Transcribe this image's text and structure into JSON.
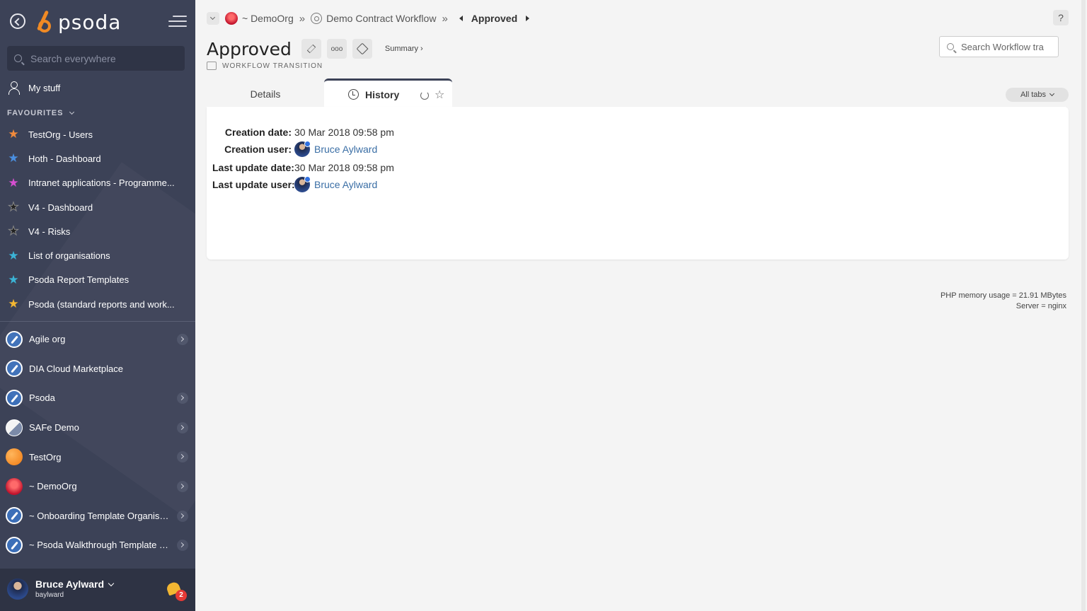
{
  "sidebar": {
    "logo_text": "psoda",
    "search_placeholder": "Search everywhere",
    "my_stuff": "My stuff",
    "favourites_header": "FAVOURITES",
    "favourites": [
      {
        "label": "TestOrg - Users",
        "color": "#f08a3c"
      },
      {
        "label": "Hoth - Dashboard",
        "color": "#4a8fe0"
      },
      {
        "label": "Intranet applications - Programme...",
        "color": "#d64fd0"
      },
      {
        "label": "V4 - Dashboard",
        "color": "#222222"
      },
      {
        "label": "V4 - Risks",
        "color": "#222222"
      },
      {
        "label": "List of organisations",
        "color": "#3bb4d6"
      },
      {
        "label": "Psoda Report Templates",
        "color": "#3bb4d6"
      },
      {
        "label": "Psoda (standard reports and work...",
        "color": "#f2b632"
      }
    ],
    "orgs": [
      {
        "label": "Agile org",
        "icon": "rocket"
      },
      {
        "label": "DIA Cloud Marketplace",
        "icon": "rocket"
      },
      {
        "label": "Psoda",
        "icon": "rocket"
      },
      {
        "label": "SAFe Demo",
        "icon": "safe"
      },
      {
        "label": "TestOrg",
        "icon": "testorg"
      },
      {
        "label": "~ DemoOrg",
        "icon": "demoorg"
      },
      {
        "label": "~ Onboarding Template Organisa...",
        "icon": "rocket"
      },
      {
        "label": "~ Psoda Walkthrough Template P...",
        "icon": "rocket"
      }
    ],
    "user": {
      "name": "Bruce Aylward",
      "login": "baylward",
      "notifications": "2"
    }
  },
  "breadcrumb": {
    "org": "~ DemoOrg",
    "workflow": "Demo Contract Workflow",
    "current": "Approved"
  },
  "help_label": "?",
  "page": {
    "title": "Approved",
    "dots_label": "ooo",
    "summary_label": "Summary ›",
    "subtitle": "WORKFLOW TRANSITION"
  },
  "search": {
    "placeholder": "Search Workflow tra"
  },
  "tabs": {
    "details": "Details",
    "history": "History",
    "all_tabs": "All tabs"
  },
  "history": {
    "creation_date_label": "Creation date:",
    "creation_date": "30 Mar 2018 09:58 pm",
    "creation_user_label": "Creation user:",
    "creation_user": "Bruce Aylward",
    "last_update_date_label": "Last update date:",
    "last_update_date": "30 Mar 2018 09:58 pm",
    "last_update_user_label": "Last update user:",
    "last_update_user": "Bruce Aylward"
  },
  "footer": {
    "memory": "PHP memory usage = 21.91 MBytes",
    "server": "Server = nginx"
  }
}
